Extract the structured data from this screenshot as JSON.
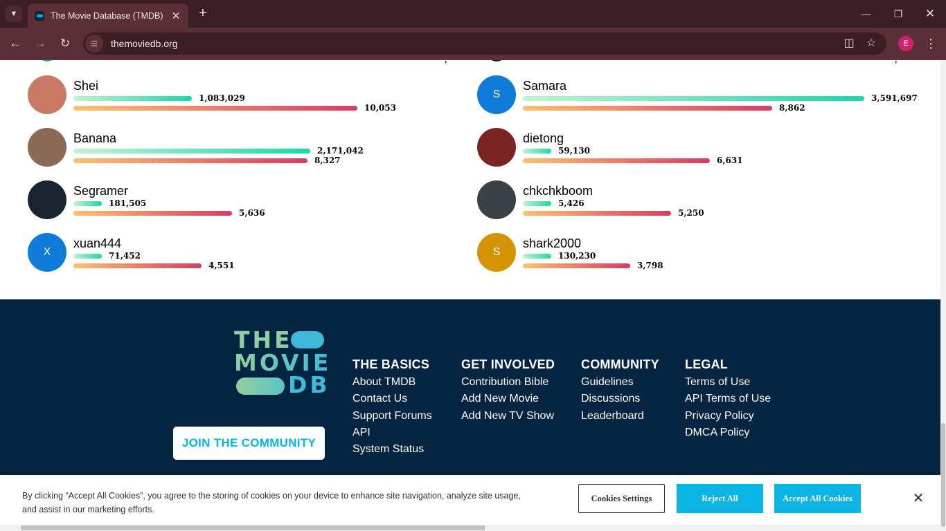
{
  "browser": {
    "tab_title": "The Movie Database (TMDB)",
    "url": "themoviedb.org",
    "profile_initial": "E",
    "icons": {
      "tab_dropdown": "chevron-down-icon",
      "close_tab": "close-icon",
      "new_tab": "plus-icon",
      "minimize": "minimize-icon",
      "restore": "restore-icon",
      "close_window": "close-icon",
      "back": "arrow-left-icon",
      "forward": "arrow-right-icon",
      "reload": "reload-icon",
      "site_info": "tune-icon",
      "install": "install-app-icon",
      "bookmark": "star-icon",
      "menu": "kebab-menu-icon"
    }
  },
  "leaderboard": {
    "left": [
      {
        "name": "Shei",
        "edits": "1,083,029",
        "edits_fraction": 0.244,
        "ratings": "10,053",
        "ratings_fraction": 0.585,
        "avatar_color": "#c97a64"
      },
      {
        "name": "Banana",
        "edits": "2,171,042",
        "edits_fraction": 0.488,
        "ratings": "8,327",
        "ratings_fraction": 0.483,
        "avatar_color": "#8a6a55"
      },
      {
        "name": "Segramer",
        "edits": "181,505",
        "edits_fraction": 0.058,
        "ratings": "5,636",
        "ratings_fraction": 0.327,
        "avatar_color": "#1a2530"
      },
      {
        "name": "xuan444",
        "edits": "71,452",
        "edits_fraction": 0.058,
        "ratings": "4,551",
        "ratings_fraction": 0.264,
        "avatar_letter": "X",
        "avatar_color": "#0d7bd7"
      }
    ],
    "right": [
      {
        "name": "Samara",
        "edits": "3,591,697",
        "edits_fraction": 0.704,
        "ratings": "8,862",
        "ratings_fraction": 0.514,
        "avatar_letter": "S",
        "avatar_color": "#0d7bd7"
      },
      {
        "name": "dietong",
        "edits": "59,130",
        "edits_fraction": 0.058,
        "ratings": "6,631",
        "ratings_fraction": 0.385,
        "avatar_color": "#7a2424"
      },
      {
        "name": "chkchkboom",
        "edits": "5,426",
        "edits_fraction": 0.058,
        "ratings": "5,250",
        "ratings_fraction": 0.305,
        "avatar_color": "#3c4148"
      },
      {
        "name": "shark2000",
        "edits": "130,230",
        "edits_fraction": 0.058,
        "ratings": "3,798",
        "ratings_fraction": 0.221,
        "avatar_letter": "S",
        "avatar_color": "#d49400"
      }
    ]
  },
  "footer": {
    "logo": {
      "line1": "THE",
      "line2": "MOVIE",
      "line3": "DB"
    },
    "join_button": "JOIN THE COMMUNITY",
    "columns": [
      {
        "heading": "THE BASICS",
        "links": [
          "About TMDB",
          "Contact Us",
          "Support Forums",
          "API",
          "System Status"
        ]
      },
      {
        "heading": "GET INVOLVED",
        "links": [
          "Contribution Bible",
          "Add New Movie",
          "Add New TV Show"
        ]
      },
      {
        "heading": "COMMUNITY",
        "links": [
          "Guidelines",
          "Discussions",
          "Leaderboard"
        ]
      },
      {
        "heading": "LEGAL",
        "links": [
          "Terms of Use",
          "API Terms of Use",
          "Privacy Policy",
          "DMCA Policy"
        ]
      }
    ],
    "colors": {
      "background": "#032541",
      "accent": "#01b4e4",
      "logo_green": "#90cea1"
    }
  },
  "cookie_banner": {
    "text": "By clicking “Accept All Cookies”, you agree to the storing of cookies on your device to enhance site navigation, analyze site usage, and assist in our marketing efforts.",
    "settings_label": "Cookies Settings",
    "reject_label": "Reject All",
    "accept_label": "Accept All Cookies",
    "close_icon": "close-icon"
  }
}
